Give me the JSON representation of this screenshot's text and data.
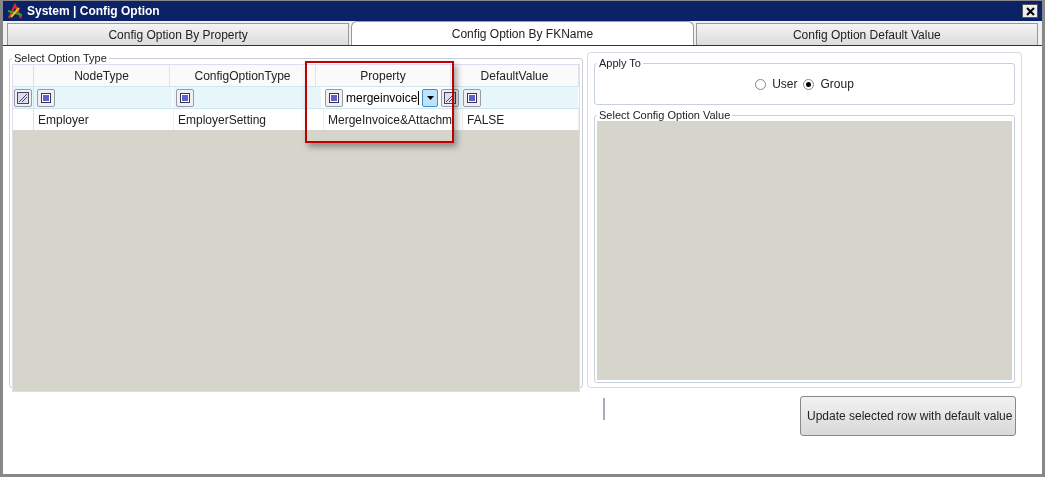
{
  "window": {
    "title": "System | Config Option"
  },
  "tabs": [
    {
      "label": "Config Option By Property",
      "selected": false
    },
    {
      "label": "Config Option By FKName",
      "selected": true
    },
    {
      "label": "Config Option Default Value",
      "selected": false
    }
  ],
  "option_type": {
    "title": "Select Option Type",
    "columns": [
      {
        "label": "NodeType"
      },
      {
        "label": "ConfigOptionType"
      },
      {
        "label": "Property",
        "filter": "mergeinvoice"
      },
      {
        "label": "DefaultValue"
      }
    ],
    "rows": [
      [
        "Employer",
        "EmployerSetting",
        "MergeInvoice&Attachm",
        "FALSE"
      ]
    ]
  },
  "apply_to": {
    "title": "Apply To",
    "options": [
      {
        "label": "User",
        "selected": false
      },
      {
        "label": "Group",
        "selected": true
      }
    ]
  },
  "config_value": {
    "title": "Select Config Option Value"
  },
  "update_button": "Update selected row with default value"
}
